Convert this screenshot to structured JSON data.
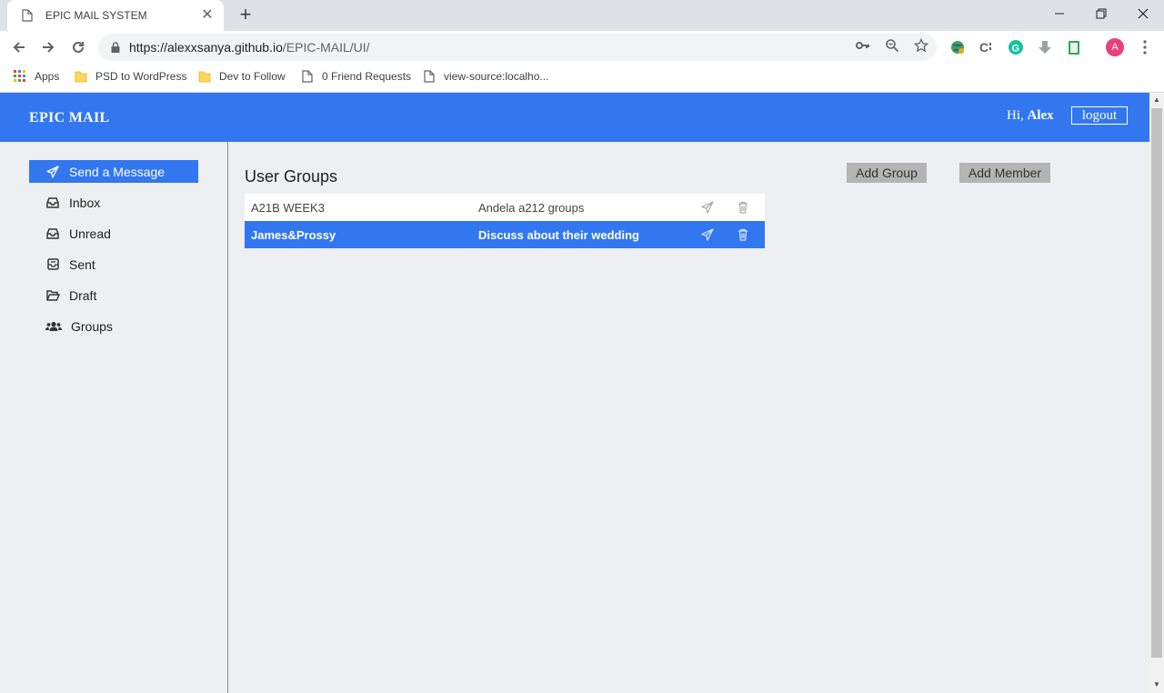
{
  "browser": {
    "tab_title": "EPIC MAIL SYSTEM",
    "url_domain": "https://alexxsanya.github.io",
    "url_path": "/EPIC-MAIL/UI/",
    "profile_initial": "A",
    "bookmarks": [
      {
        "label": "Apps",
        "icon": "apps-grid-icon"
      },
      {
        "label": "PSD to WordPress",
        "icon": "folder-icon"
      },
      {
        "label": "Dev to Follow",
        "icon": "folder-icon"
      },
      {
        "label": "0 Friend Requests",
        "icon": "page-icon"
      },
      {
        "label": "view-source:localho...",
        "icon": "page-icon"
      }
    ]
  },
  "app": {
    "brand": "EPIC MAIL",
    "greeting_prefix": "Hi,",
    "user_name": "Alex",
    "logout_label": "logout"
  },
  "sidebar": {
    "items": [
      {
        "label": "Send a Message",
        "icon": "paper-plane-icon",
        "active": true
      },
      {
        "label": "Inbox",
        "icon": "inbox-icon"
      },
      {
        "label": "Unread",
        "icon": "inbox-icon"
      },
      {
        "label": "Sent",
        "icon": "envelope-open-icon"
      },
      {
        "label": "Draft",
        "icon": "folder-open-icon"
      },
      {
        "label": "Groups",
        "icon": "users-icon"
      }
    ]
  },
  "main": {
    "title": "User Groups",
    "add_group_label": "Add Group",
    "add_member_label": "Add Member",
    "groups": [
      {
        "name": "A21B WEEK3",
        "description": "Andela a212 groups",
        "selected": false
      },
      {
        "name": "James&Prossy",
        "description": "Discuss about their wedding",
        "selected": true
      }
    ]
  },
  "colors": {
    "accent": "#3277f0",
    "page_background": "#edeff2",
    "button_gray": "#b4b4b4"
  }
}
